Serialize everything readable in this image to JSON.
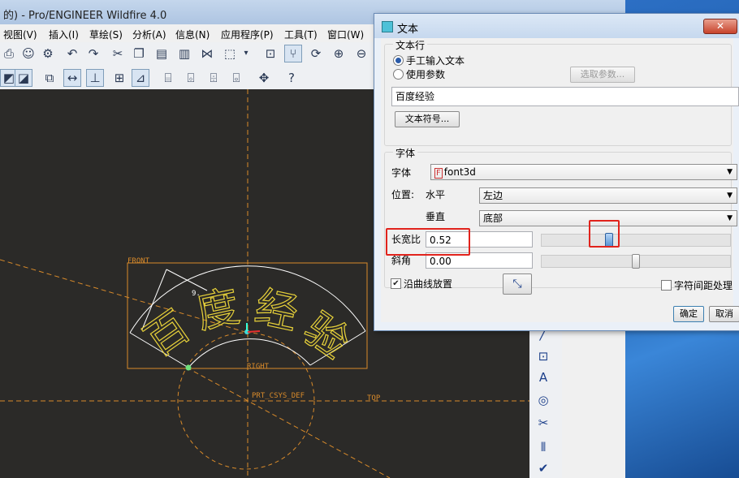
{
  "app": {
    "title": "的) - Pro/ENGINEER Wildfire 4.0"
  },
  "menu": [
    {
      "label": "视图(V)"
    },
    {
      "label": "插入(I)"
    },
    {
      "label": "草绘(S)"
    },
    {
      "label": "分析(A)"
    },
    {
      "label": "信息(N)"
    },
    {
      "label": "应用程序(P)"
    },
    {
      "label": "工具(T)"
    },
    {
      "label": "窗口(W)"
    }
  ],
  "canvas": {
    "labels": {
      "front": "FRONT",
      "right": "RIGHT",
      "top": "TOP",
      "csys": "PRT_CSYS_DEF",
      "dim": "9."
    },
    "arc_text_glyphs": [
      "百",
      "度",
      "经",
      "验"
    ],
    "colors": {
      "background": "#2b2a28",
      "datum": "#d88a2a",
      "text": "#e8d23a",
      "arc": "#ffffff"
    }
  },
  "dialog": {
    "title": "文本",
    "close_label": "✕",
    "text_line_group": "文本行",
    "radio_manual": "手工输入文本",
    "radio_param": "使用参数",
    "select_param_button": "选取参数...",
    "text_value": "百度经验",
    "text_symbol_button": "文本符号...",
    "font_group": "字体",
    "font_label": "字体",
    "font_value": "font3d",
    "position_label": "位置:",
    "horizontal_label": "水平",
    "horizontal_value": "左边",
    "vertical_label": "垂直",
    "vertical_value": "底部",
    "aspect_label": "长宽比",
    "aspect_value": "0.52",
    "aspect_slider_fraction": 0.35,
    "slant_label": "斜角",
    "slant_value": "0.00",
    "slant_slider_fraction": 0.5,
    "place_on_curve_label": "沿曲线放置",
    "place_on_curve_checked": true,
    "kerning_label": "字符间距处理",
    "kerning_checked": false,
    "ok_button": "确定",
    "cancel_button": "取消"
  }
}
